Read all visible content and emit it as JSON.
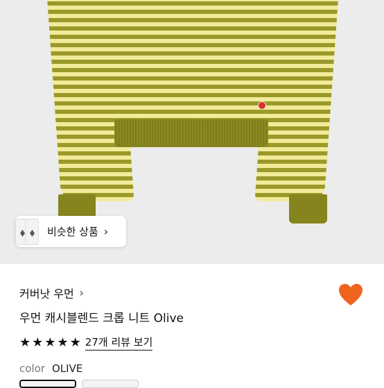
{
  "hero": {
    "image_alt": "striped cropped knit sweater",
    "stripe_colors": [
      "#9a9a2a",
      "#f2eb9a"
    ],
    "rib_color": "#85841d"
  },
  "similar": {
    "label": "비슷한 상품",
    "chevron": "›"
  },
  "brand": {
    "name": "커버낫 우먼",
    "chevron": "›"
  },
  "product": {
    "name": "우먼 캐시블렌드 크롭 니트 Olive"
  },
  "rating": {
    "stars": [
      "★",
      "★",
      "★",
      "★",
      "★"
    ],
    "value": 5,
    "review_link": "27개 리뷰 보기"
  },
  "color": {
    "label": "color",
    "value": "OLIVE"
  },
  "icons": {
    "wishlist": "heart-icon",
    "star": "star-icon",
    "chevron": "chevron-right-icon"
  },
  "colors": {
    "heart": "#f0641e",
    "text": "#111111",
    "muted": "#777777"
  }
}
